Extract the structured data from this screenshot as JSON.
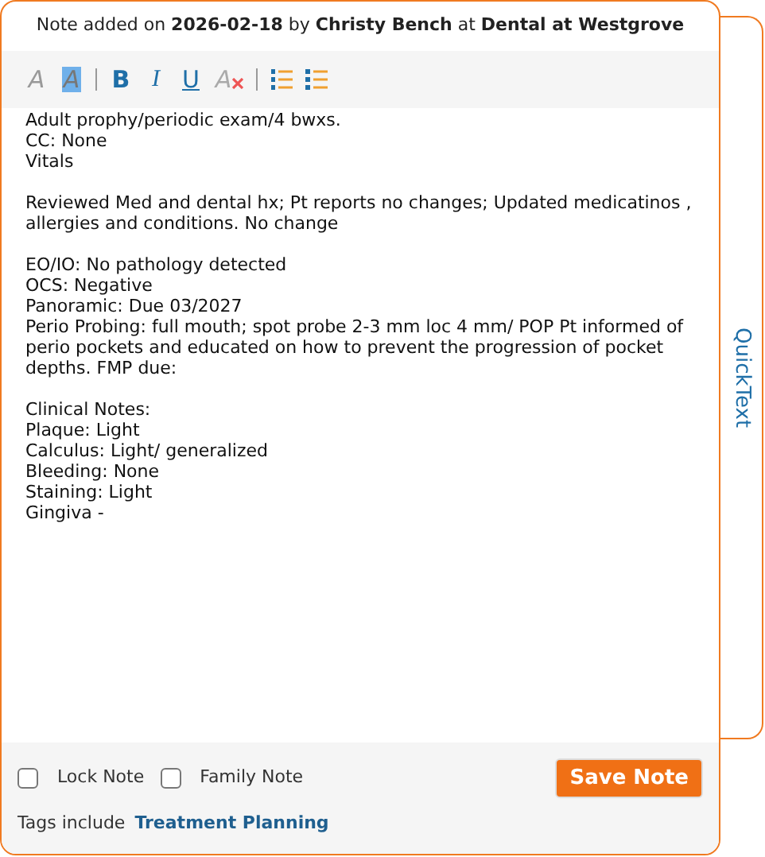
{
  "header": "Note added on **2026-02-18** by **Christy Bench** at **Dental at Westgrove**",
  "toolbar": [
    {
      "kind": "font",
      "label": "A"
    },
    {
      "kind": "highlight",
      "label": "A"
    },
    {
      "kind": "divider"
    },
    {
      "kind": "bold",
      "label": "B"
    },
    {
      "kind": "italic",
      "label": "I"
    },
    {
      "kind": "underline",
      "label": "U"
    },
    {
      "kind": "clear",
      "label": "A"
    },
    {
      "kind": "divider"
    },
    {
      "kind": "numbered-list"
    },
    {
      "kind": "bullet-list"
    }
  ],
  "note_paragraphs": [
    [
      "Adult prophy/periodic exam/4 bwxs.",
      "CC: None",
      "Vitals"
    ],
    [
      "Reviewed Med and dental hx; Pt reports no changes; Updated medicatinos , allergies and conditions. No change"
    ],
    [
      "EO/IO: No pathology detected",
      "OCS: Negative",
      "Panoramic: Due 03/2027",
      "Perio Probing: full mouth; spot probe 2-3 mm loc 4 mm/ POP Pt informed of perio pockets and educated on how to prevent the progression of pocket depths. FMP due:"
    ],
    [
      "Clinical Notes:",
      "Plaque: Light",
      "Calculus: Light/ generalized",
      "Bleeding: None",
      "Staining: Light",
      "Gingiva -"
    ]
  ],
  "side_tab": "QuickText",
  "options": [
    {
      "label": "Lock Note",
      "checked": false
    },
    {
      "label": "Family Note",
      "checked": false
    }
  ],
  "save_button": "Save Note",
  "tags": {
    "label": "Tags include",
    "link": "Treatment Planning"
  }
}
